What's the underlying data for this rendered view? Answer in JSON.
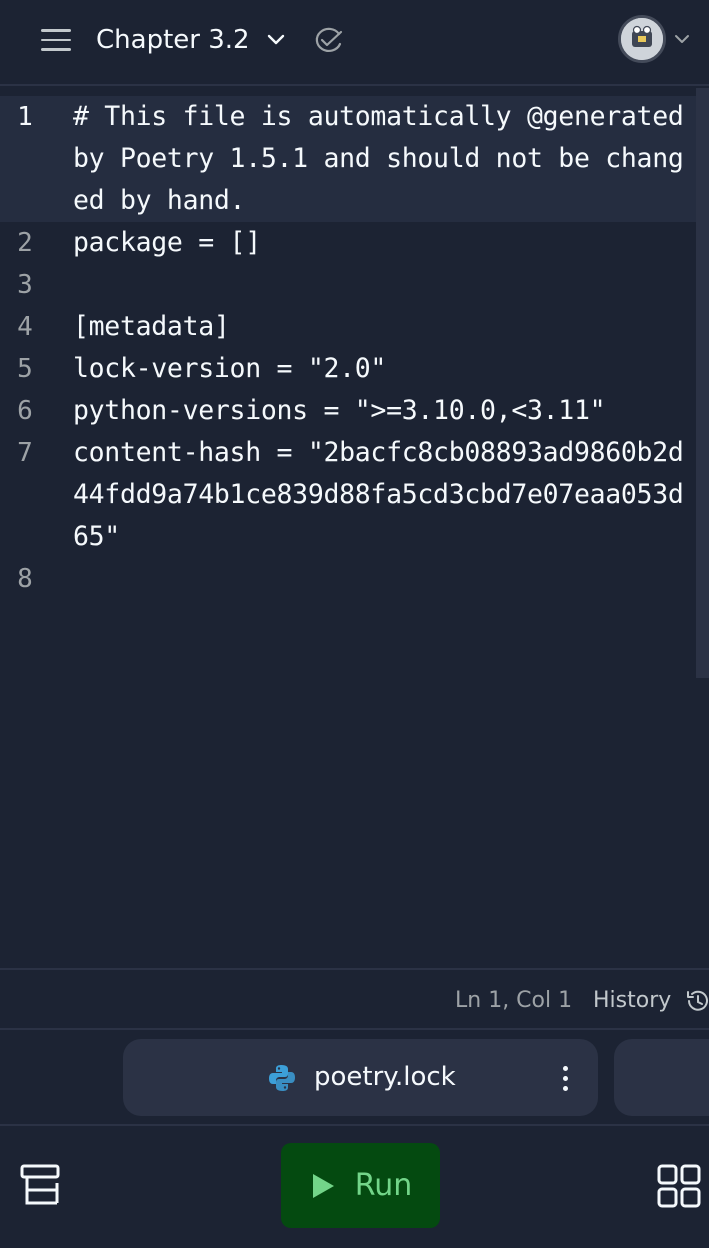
{
  "header": {
    "title": "Chapter 3.2",
    "icons": [
      "menu-icon",
      "chevron-down-icon",
      "check-cloud-icon",
      "avatar",
      "chevron-down-icon"
    ]
  },
  "editor": {
    "lines": [
      {
        "number": "1",
        "text": "# This file is automatically @generated by Poetry 1.5.1 and should not be changed by hand."
      },
      {
        "number": "2",
        "text": "package = []"
      },
      {
        "number": "3",
        "text": ""
      },
      {
        "number": "4",
        "text": "[metadata]"
      },
      {
        "number": "5",
        "text": "lock-version = \"2.0\""
      },
      {
        "number": "6",
        "text": "python-versions = \">=3.10.0,<3.11\""
      },
      {
        "number": "7",
        "text": "content-hash = \"2bacfc8cb08893ad9860b2d44fdd9a74b1ce839d88fa5cd3cbd7e07eaa053d65\""
      },
      {
        "number": "8",
        "text": ""
      }
    ]
  },
  "status": {
    "position": "Ln 1, Col 1",
    "history_label": "History"
  },
  "tabs": {
    "active_file": "poetry.lock"
  },
  "bottom": {
    "run_label": "Run"
  },
  "colors": {
    "background": "#1c2333",
    "surface": "#2b3245",
    "run_bg": "#044a10",
    "run_fg": "#73d589",
    "python_blue": "#3c9fd8"
  }
}
